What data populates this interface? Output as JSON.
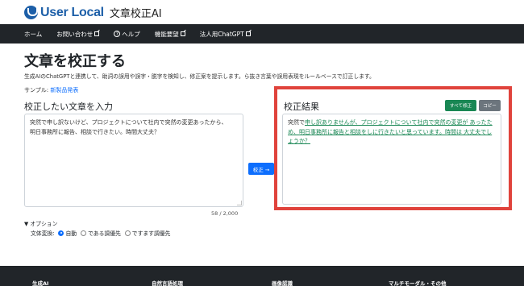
{
  "brand": {
    "logo": "User Local",
    "title": "文章校正AI"
  },
  "nav": {
    "items": [
      {
        "label": "ホーム"
      },
      {
        "label": "お問い合わせ"
      },
      {
        "label": "ヘルプ"
      },
      {
        "label": "機能要望"
      },
      {
        "label": "法人用ChatGPT"
      }
    ]
  },
  "main": {
    "title": "文章を校正する",
    "description": "生成AIのChatGPTと連携して、助詞の誤用や誤字・脱字を検知し、修正案を提示します。ら抜き言葉や誤用表現をルールベースで訂正します。",
    "sample_label": "サンプル:",
    "sample_link": "新製品発表"
  },
  "input": {
    "label": "校正したい文章を入力",
    "line1": "突然で申し訳ないけど、プロジェクトについて社内で突然の変更あったから、",
    "line2": "明日事務所に報告、相談で行きたい。時間大丈夫？",
    "counter": "58 / 2,000"
  },
  "fix_button": "校正 →",
  "result": {
    "label": "校正結果",
    "fix_all": "すべて修正",
    "copy": "コピー",
    "plain_start": "突然で",
    "corrected": "申し訳ありませんが、プロジェクトについて社内で突然の変更が あったため、明日事務所に報告と相談をしに行きたいと思っています。時間は 大丈夫でしょうか？"
  },
  "options": {
    "toggle": "▼ オプション",
    "label": "文体変換:",
    "choices": [
      {
        "label": "自動",
        "selected": true
      },
      {
        "label": "である調優先",
        "selected": false
      },
      {
        "label": "ですます調優先",
        "selected": false
      }
    ]
  },
  "footer": {
    "items": [
      {
        "label": "生成AI"
      },
      {
        "label": "自然言語処理"
      },
      {
        "label": "画像認識"
      },
      {
        "label": "マルチモーダル・その他"
      }
    ]
  },
  "colors": {
    "brand": "#1d5fa8",
    "nav_bg": "#212529",
    "primary": "#0d6efd",
    "success": "#198754",
    "highlight": "#e0433c"
  }
}
